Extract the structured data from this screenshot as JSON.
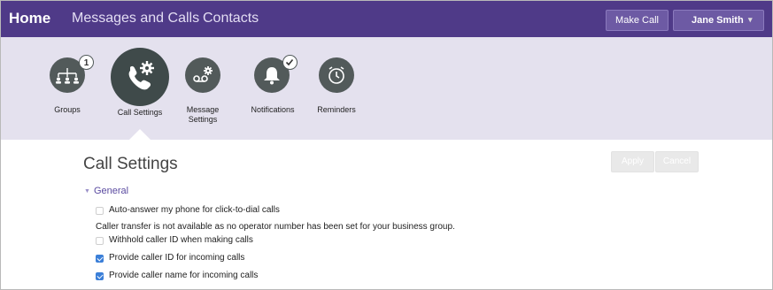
{
  "nav": {
    "home": "Home",
    "messages_calls": "Messages and Calls",
    "contacts": "Contacts",
    "make_call": "Make Call",
    "user_name": "Jane Smith",
    "user_caret": "▾"
  },
  "icons": {
    "groups": {
      "label": "Groups",
      "badge": "1",
      "icon": "org-tree-icon"
    },
    "call_settings": {
      "label": "Call Settings",
      "icon": "phone-gear-icon",
      "active": true
    },
    "message_settings": {
      "label_line1": "Message",
      "label_line2": "Settings",
      "icon": "voicemail-gear-icon"
    },
    "notifications": {
      "label": "Notifications",
      "badge_icon": "check-icon",
      "icon": "bell-icon"
    },
    "reminders": {
      "label": "Reminders",
      "icon": "alarm-clock-icon"
    }
  },
  "content": {
    "title": "Call Settings",
    "apply": "Apply",
    "cancel": "Cancel",
    "section": "General",
    "section_arrow": "▼",
    "options": [
      {
        "label": "Auto-answer my phone for click-to-dial calls",
        "checked": false
      },
      {
        "label": "Withhold caller ID when making calls",
        "checked": false
      },
      {
        "label": "Provide caller ID for incoming calls",
        "checked": true
      },
      {
        "label": "Provide caller name for incoming calls",
        "checked": true
      }
    ],
    "transfer_note": "Caller transfer is not available as no operator number has been set for your business group."
  },
  "colors": {
    "nav_bg": "#4f3a88",
    "band_bg": "#e4e1ee",
    "icon_circle": "#525a5a",
    "checkbox_on": "#3b7fd8",
    "section_text": "#5a4aa0"
  }
}
